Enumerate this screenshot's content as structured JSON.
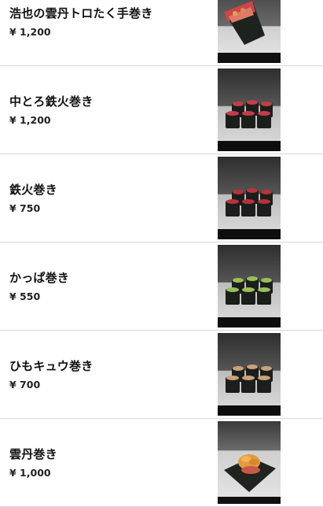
{
  "menu": {
    "items": [
      {
        "name": "浩也の雲丹トロたく手巻き",
        "price": "¥ 1,200",
        "photo": "hand-roll-tuna-uni-photo"
      },
      {
        "name": "中とろ鉄火巻き",
        "price": "¥ 1,200",
        "photo": "chutoro-tekka-maki-photo"
      },
      {
        "name": "鉄火巻き",
        "price": "¥ 750",
        "photo": "tekka-maki-photo"
      },
      {
        "name": "かっぱ巻き",
        "price": "¥ 550",
        "photo": "kappa-maki-photo"
      },
      {
        "name": "ひもキュウ巻き",
        "price": "¥ 700",
        "photo": "himo-kyu-maki-photo"
      },
      {
        "name": "雲丹巻き",
        "price": "¥ 1,000",
        "photo": "uni-maki-photo"
      }
    ]
  }
}
